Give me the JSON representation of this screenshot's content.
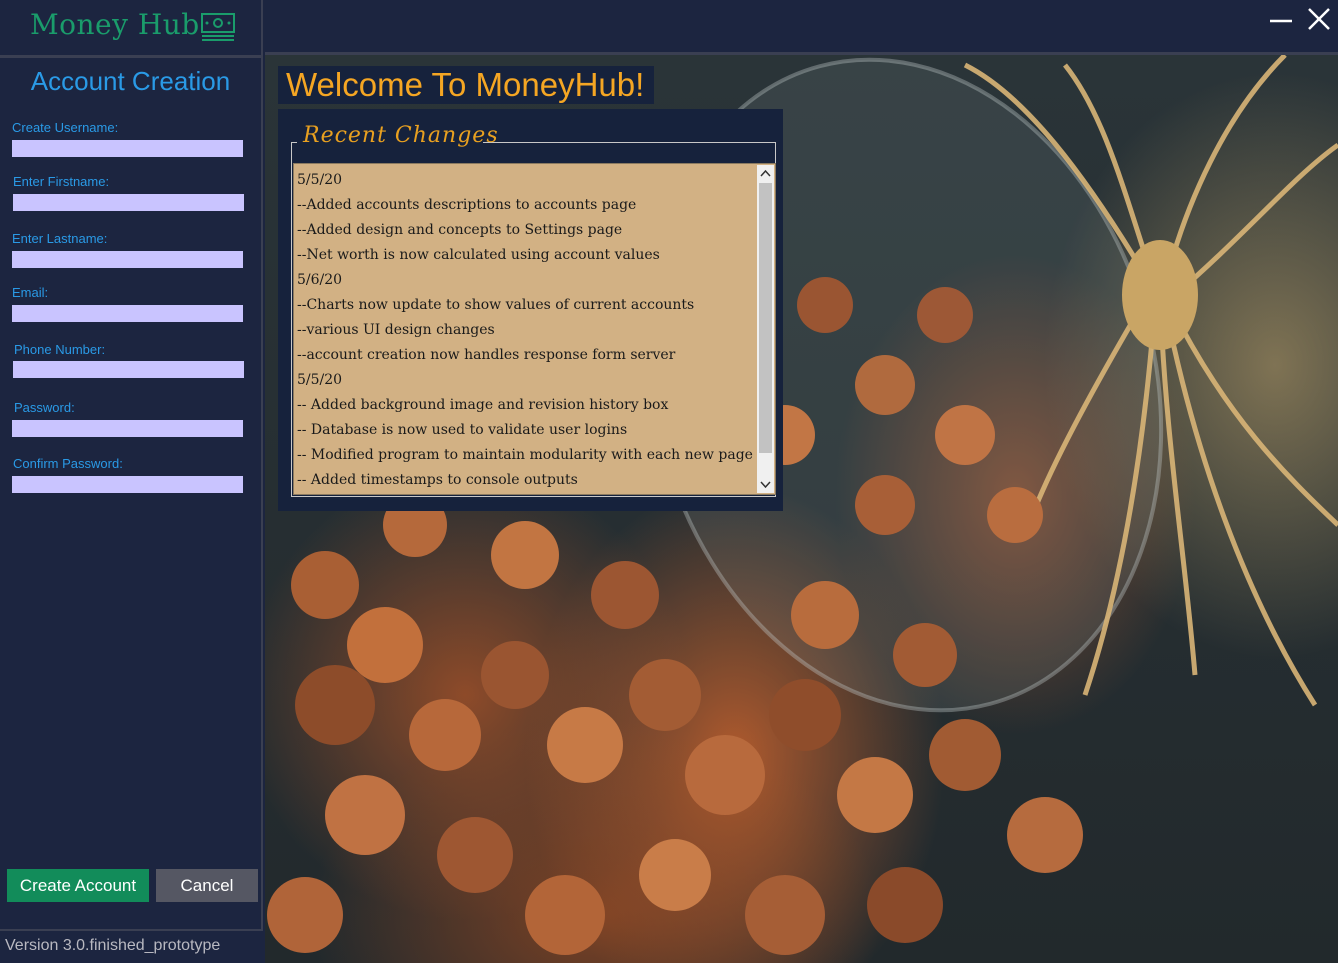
{
  "app": {
    "logo_text": "Money Hub",
    "version": "Version 3.0.finished_prototype"
  },
  "sidebar": {
    "title": "Account Creation",
    "fields": [
      {
        "label": "Create Username:",
        "value": ""
      },
      {
        "label": "Enter Firstname:",
        "value": ""
      },
      {
        "label": "Enter Lastname:",
        "value": ""
      },
      {
        "label": "Email:",
        "value": ""
      },
      {
        "label": "Phone Number:",
        "value": ""
      },
      {
        "label": "Password:",
        "value": ""
      },
      {
        "label": "Confirm Password:",
        "value": ""
      }
    ],
    "create_button": "Create Account",
    "cancel_button": "Cancel"
  },
  "main": {
    "welcome": "Welcome To MoneyHub!",
    "changes_heading": "Recent  Changes",
    "changes": [
      "5/5/20",
      "--Added accounts descriptions to accounts page",
      "--Added design and concepts to Settings page",
      "--Net worth is now calculated using account values",
      "5/6/20",
      "--Charts now update to show values of current accounts",
      "--various UI design changes",
      "--account creation now handles response form server",
      "5/5/20",
      "-- Added background image and revision history box",
      "-- Database is now used to validate user logins",
      "-- Modified program to maintain modularity with each new page",
      "-- Added timestamps to console outputs"
    ]
  },
  "colors": {
    "background": "#1c2540",
    "accent_blue": "#2a9ae6",
    "brand_green": "#1a9c6b",
    "welcome_orange": "#f5a623",
    "input_fill": "#c9c4ff",
    "changes_bg": "#d2b184"
  },
  "icons": {
    "logo": "money-bill-icon",
    "minimize": "minimize-icon",
    "close": "close-icon"
  }
}
